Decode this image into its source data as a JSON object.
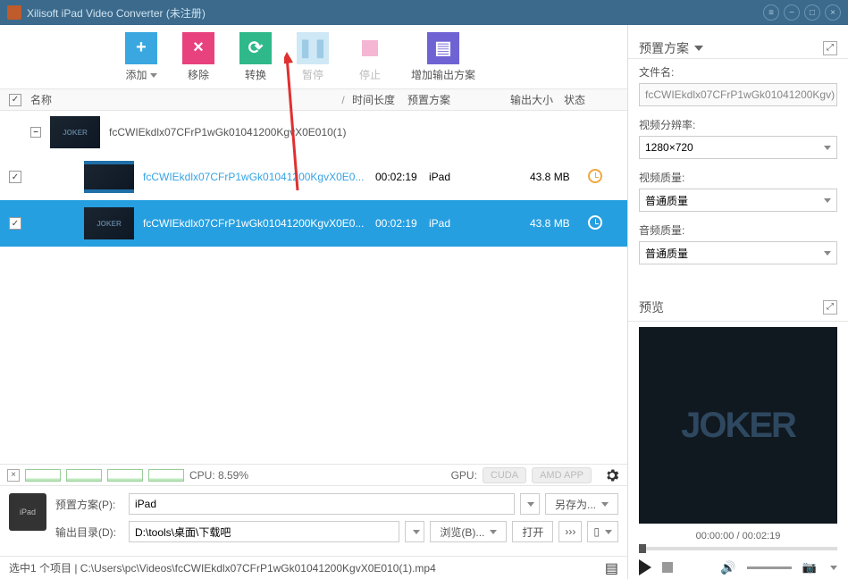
{
  "titlebar": {
    "title": "Xilisoft iPad Video Converter (未注册)"
  },
  "toolbar": {
    "add": "添加",
    "remove": "移除",
    "convert": "转换",
    "pause": "暂停",
    "stop": "停止",
    "add_output": "增加输出方案"
  },
  "table": {
    "header": {
      "name": "名称",
      "sort": "/",
      "duration": "时间长度",
      "preset": "预置方案",
      "size": "输出大小",
      "status": "状态"
    },
    "parent": {
      "name": "fcCWIEkdlx07CFrP1wGk01041200KgvX0E010(1)"
    },
    "rows": [
      {
        "name": "fcCWIEkdlx07CFrP1wGk01041200KgvX0E0...",
        "duration": "00:02:19",
        "preset": "iPad",
        "size": "43.8 MB"
      },
      {
        "name": "fcCWIEkdlx07CFrP1wGk01041200KgvX0E0...",
        "duration": "00:02:19",
        "preset": "iPad",
        "size": "43.8 MB"
      }
    ]
  },
  "cpu": {
    "label": "CPU: 8.59%",
    "gpu_label": "GPU:",
    "cuda": "CUDA",
    "amd": "AMD APP"
  },
  "bottom": {
    "preset_label": "预置方案(P):",
    "preset_value": "iPad",
    "saveas": "另存为...",
    "output_label": "输出目录(D):",
    "output_value": "D:\\tools\\桌面\\下载吧",
    "browse": "浏览(B)...",
    "open": "打开"
  },
  "statusbar": {
    "text": "选中1 个项目 | C:\\Users\\pc\\Videos\\fcCWIEkdlx07CFrP1wGk01041200KgvX0E010(1).mp4"
  },
  "right": {
    "preset_header": "预置方案",
    "filename_label": "文件名:",
    "filename_value": "fcCWIEkdlx07CFrP1wGk01041200Kgv)",
    "resolution_label": "视频分辨率:",
    "resolution_value": "1280×720",
    "vquality_label": "视频质量:",
    "vquality_value": "普通质量",
    "aquality_label": "音频质量:",
    "aquality_value": "普通质量",
    "preview_header": "预览",
    "time": "00:00:00 / 00:02:19"
  }
}
